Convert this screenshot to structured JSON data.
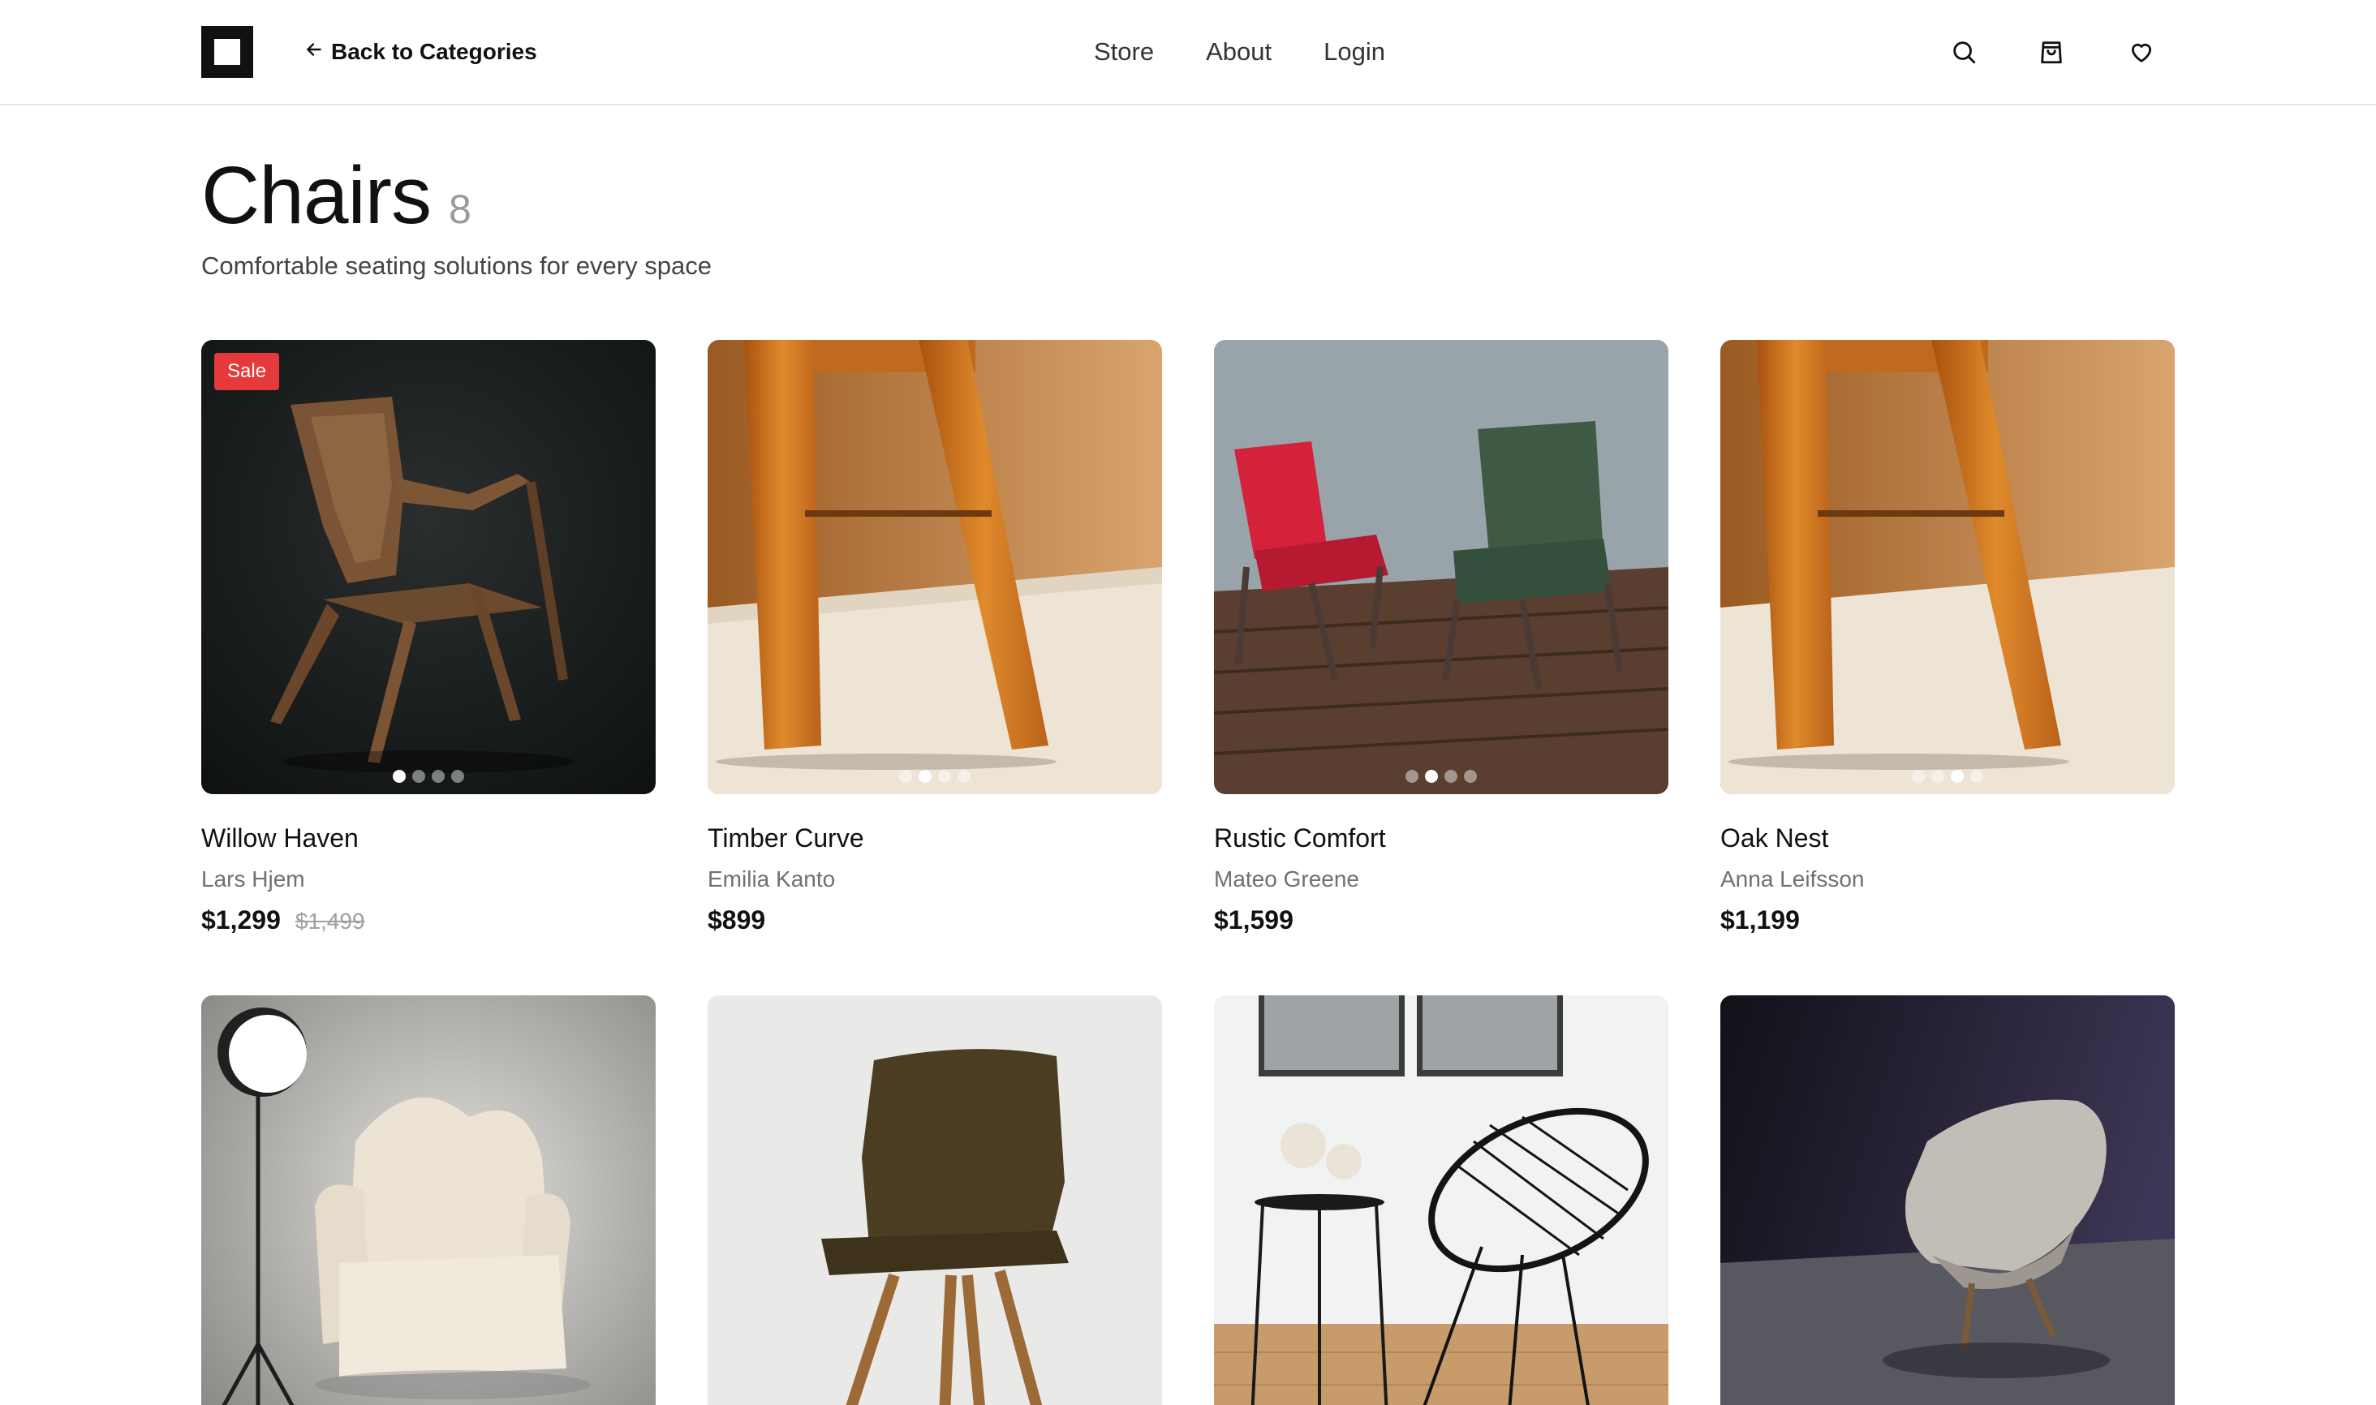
{
  "header": {
    "back_label": "Back to Categories",
    "nav": [
      {
        "label": "Store"
      },
      {
        "label": "About"
      },
      {
        "label": "Login"
      }
    ],
    "icons": [
      "search-icon",
      "shopping-bag-icon",
      "heart-icon"
    ]
  },
  "page": {
    "title": "Chairs",
    "count": "8",
    "subtitle": "Comfortable seating solutions for every space"
  },
  "colors": {
    "accent_sale": "#e5393b",
    "text_primary": "#111111",
    "text_muted": "#707070"
  },
  "products": [
    {
      "name": "Willow Haven",
      "designer": "Lars Hjem",
      "price": "$1,299",
      "old_price": "$1,499",
      "badge": "Sale",
      "image_count": 4,
      "active_image": 1
    },
    {
      "name": "Timber Curve",
      "designer": "Emilia Kanto",
      "price": "$899",
      "image_count": 4,
      "active_image": 2
    },
    {
      "name": "Rustic Comfort",
      "designer": "Mateo Greene",
      "price": "$1,599",
      "image_count": 4,
      "active_image": 2
    },
    {
      "name": "Oak Nest",
      "designer": "Anna Leifsson",
      "price": "$1,199",
      "image_count": 4,
      "active_image": 3
    },
    {
      "name": "",
      "designer": "",
      "price": ""
    },
    {
      "name": "",
      "designer": "",
      "price": ""
    },
    {
      "name": "",
      "designer": "",
      "price": ""
    },
    {
      "name": "",
      "designer": "",
      "price": ""
    }
  ]
}
